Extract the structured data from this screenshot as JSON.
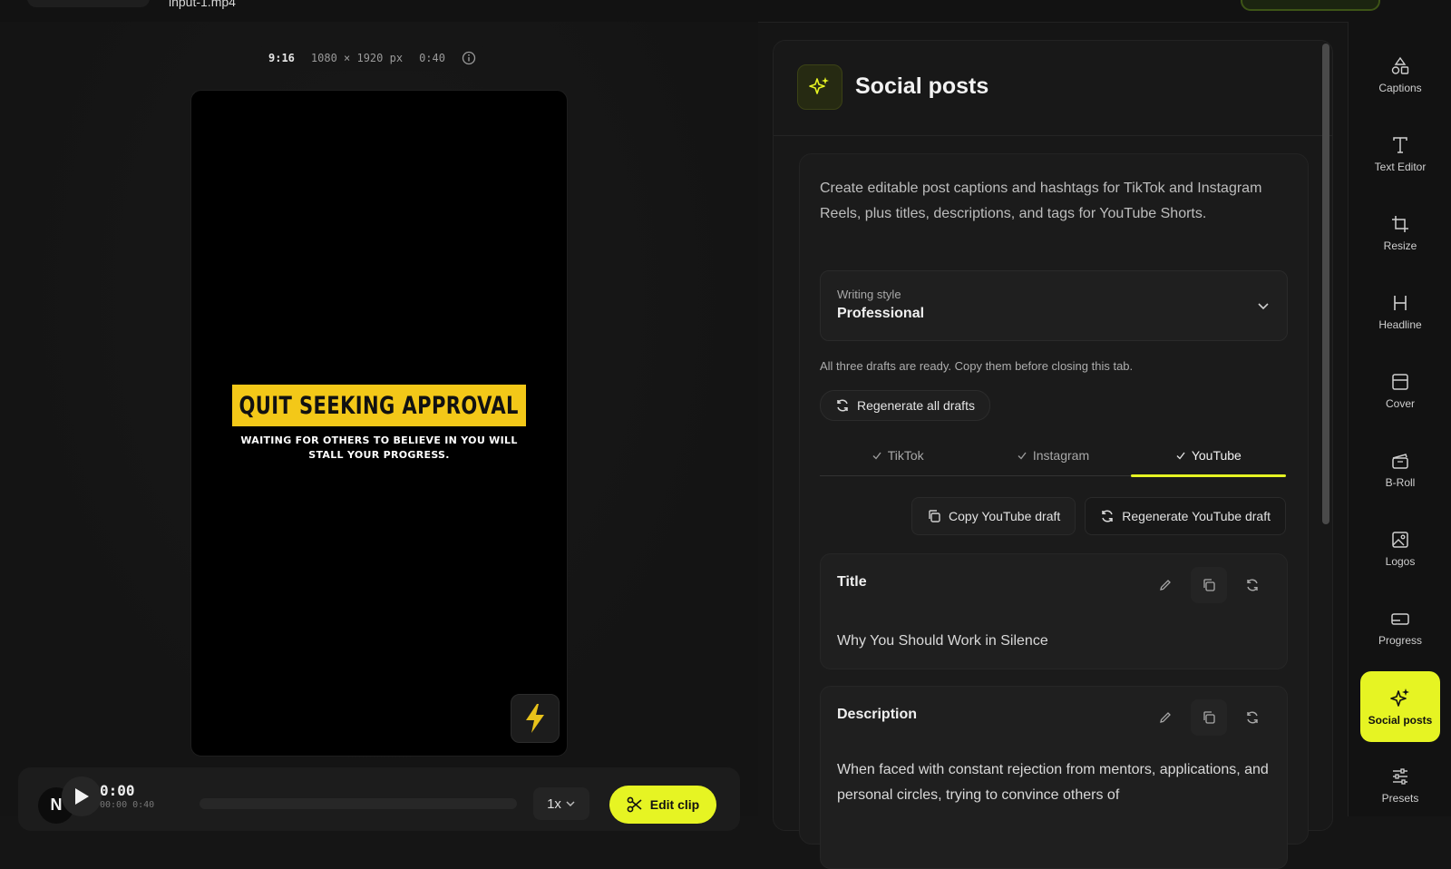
{
  "top": {
    "filename": "input-1.mp4"
  },
  "preview": {
    "aspect_ratio": "9:16",
    "resolution": "1080 × 1920 px",
    "duration": "0:40",
    "caption_headline": "QUIT SEEKING APPROVAL",
    "caption_subline": "WAITING FOR OTHERS TO BELIEVE IN YOU WILL STALL YOUR PROGRESS."
  },
  "playback": {
    "avatar_letter": "N",
    "current_time": "0:00",
    "time_range": "00:00 0:40",
    "speed": "1x",
    "edit_clip_label": "Edit clip",
    "progress": 0
  },
  "panel": {
    "title": "Social posts",
    "intro": "Create editable post captions and hashtags for TikTok and Instagram Reels, plus titles, descriptions, and tags for YouTube Shorts.",
    "writing_style_label": "Writing style",
    "writing_style_value": "Professional",
    "status": "All three drafts are ready. Copy them before closing this tab.",
    "regen_all_label": "Regenerate all drafts",
    "tabs": [
      {
        "label": "TikTok"
      },
      {
        "label": "Instagram"
      },
      {
        "label": "YouTube"
      }
    ],
    "active_tab": "YouTube",
    "copy_label": "Copy YouTube draft",
    "regen_label": "Regenerate YouTube draft",
    "title_field": {
      "label": "Title",
      "value": "Why You Should Work in Silence"
    },
    "desc_field": {
      "label": "Description",
      "value": "When faced with constant rejection from mentors, applications, and personal circles, trying to convince others of"
    }
  },
  "rail": [
    {
      "label": "Captions",
      "icon": "shapes-icon"
    },
    {
      "label": "Text Editor",
      "icon": "text-icon"
    },
    {
      "label": "Resize",
      "icon": "crop-icon"
    },
    {
      "label": "Headline",
      "icon": "heading-icon"
    },
    {
      "label": "Cover",
      "icon": "cover-icon"
    },
    {
      "label": "B-Roll",
      "icon": "broll-icon"
    },
    {
      "label": "Logos",
      "icon": "image-icon"
    },
    {
      "label": "Progress",
      "icon": "progress-icon"
    },
    {
      "label": "Social posts",
      "icon": "sparkle-icon"
    },
    {
      "label": "Presets",
      "icon": "sliders-icon"
    }
  ],
  "colors": {
    "accent": "#e6f423",
    "caption_box": "#f3c818"
  }
}
